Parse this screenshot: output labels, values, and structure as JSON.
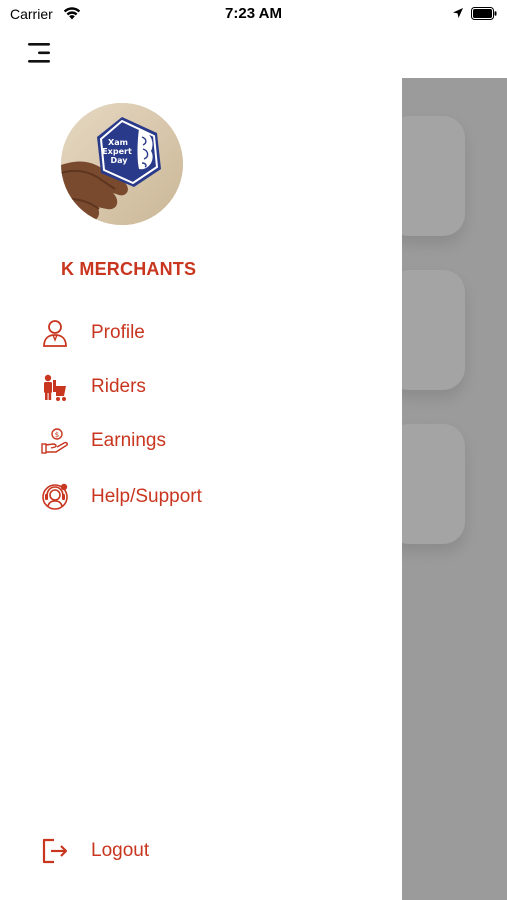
{
  "status_bar": {
    "carrier": "Carrier",
    "time": "7:23 AM"
  },
  "header": {
    "menu_icon": "hamburger-menu-icon"
  },
  "drawer": {
    "merchant_name": "K MERCHANTS",
    "avatar_badge_text": "Xam Expert Day",
    "items": [
      {
        "label": "Profile",
        "icon": "person-icon"
      },
      {
        "label": "Riders",
        "icon": "rider-icon"
      },
      {
        "label": "Earnings",
        "icon": "earnings-icon"
      },
      {
        "label": "Help/Support",
        "icon": "support-icon"
      }
    ],
    "logout": {
      "label": "Logout",
      "icon": "logout-icon"
    }
  },
  "colors": {
    "accent": "#c8361f",
    "overlay": "#9b9b9b"
  }
}
